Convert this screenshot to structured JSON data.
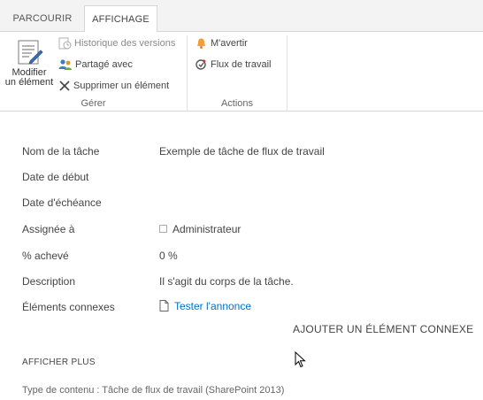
{
  "tabs": [
    {
      "label": "PARCOURIR"
    },
    {
      "label": "AFFICHAGE"
    }
  ],
  "ribbon": {
    "groups": {
      "manage": {
        "label": "Gérer",
        "edit_item": {
          "line1": "Modifier",
          "line2": "un élément",
          "icon": "edit-form-icon"
        },
        "version_history": {
          "label": "Historique des versions",
          "icon": "history-icon"
        },
        "shared_with": {
          "label": "Partagé avec",
          "icon": "people-icon"
        },
        "delete_item": {
          "label": "Supprimer un élément",
          "icon": "delete-x-icon"
        }
      },
      "actions": {
        "label": "Actions",
        "alert_me": {
          "label": "M'avertir",
          "icon": "bell-icon"
        },
        "workflows": {
          "label": "Flux de travail",
          "icon": "workflow-icon"
        }
      }
    }
  },
  "form": {
    "rows": [
      {
        "label": "Nom de la tâche",
        "value": "Exemple de tâche de flux de travail"
      },
      {
        "label": "Date de début",
        "value": ""
      },
      {
        "label": "Date d'échéance",
        "value": ""
      },
      {
        "label": "Assignée à",
        "value": "Administrateur"
      },
      {
        "label": "% achevé",
        "value": "0 %"
      },
      {
        "label": "Description",
        "value": "Il s'agit du corps de la tâche."
      },
      {
        "label": "Éléments connexes",
        "value": "Tester l'annonce"
      }
    ],
    "add_related": "AJOUTER UN ÉLÉMENT CONNEXE",
    "show_more": "AFFICHER PLUS",
    "content_type": "Type de contenu : Tâche de flux de travail (SharePoint 2013)"
  },
  "colors": {
    "accent": "#0072c6",
    "ribbon_bg": "#f3f3f3",
    "bell": "#f0a030",
    "text": "#444444"
  }
}
